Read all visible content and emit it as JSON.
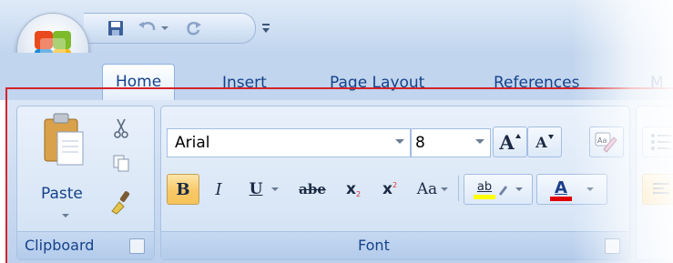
{
  "tabs": [
    "Home",
    "Insert",
    "Page Layout",
    "References",
    "M"
  ],
  "active_tab": "Home",
  "quick_access": {
    "icons": [
      "save-icon",
      "undo-icon",
      "redo-icon",
      "customize-icon"
    ]
  },
  "clipboard": {
    "label": "Clipboard",
    "paste_label": "Paste",
    "icons": [
      "paste-icon",
      "cut-icon",
      "copy-icon",
      "format-painter-icon"
    ]
  },
  "font": {
    "label": "Font",
    "font_name": "Arial",
    "font_size": "8",
    "grow_glyph": "A",
    "shrink_glyph": "A",
    "bold_glyph": "B",
    "italic_glyph": "I",
    "underline_glyph": "U",
    "strike_glyph": "abe",
    "subscript_glyph": "x",
    "subscript_mark": "2",
    "superscript_glyph": "x",
    "superscript_mark": "2",
    "case_glyph": "Aa",
    "clear_glyph": "Aa",
    "highlight_glyph": "ab",
    "color_glyph": "A",
    "highlight_color": "#ffff00",
    "font_color": "#e00000"
  },
  "colors": {
    "ribbon": "#c9dbf1",
    "text": "#15428b",
    "guide_line": "#d6232a",
    "bold_active": "#f8c969"
  }
}
